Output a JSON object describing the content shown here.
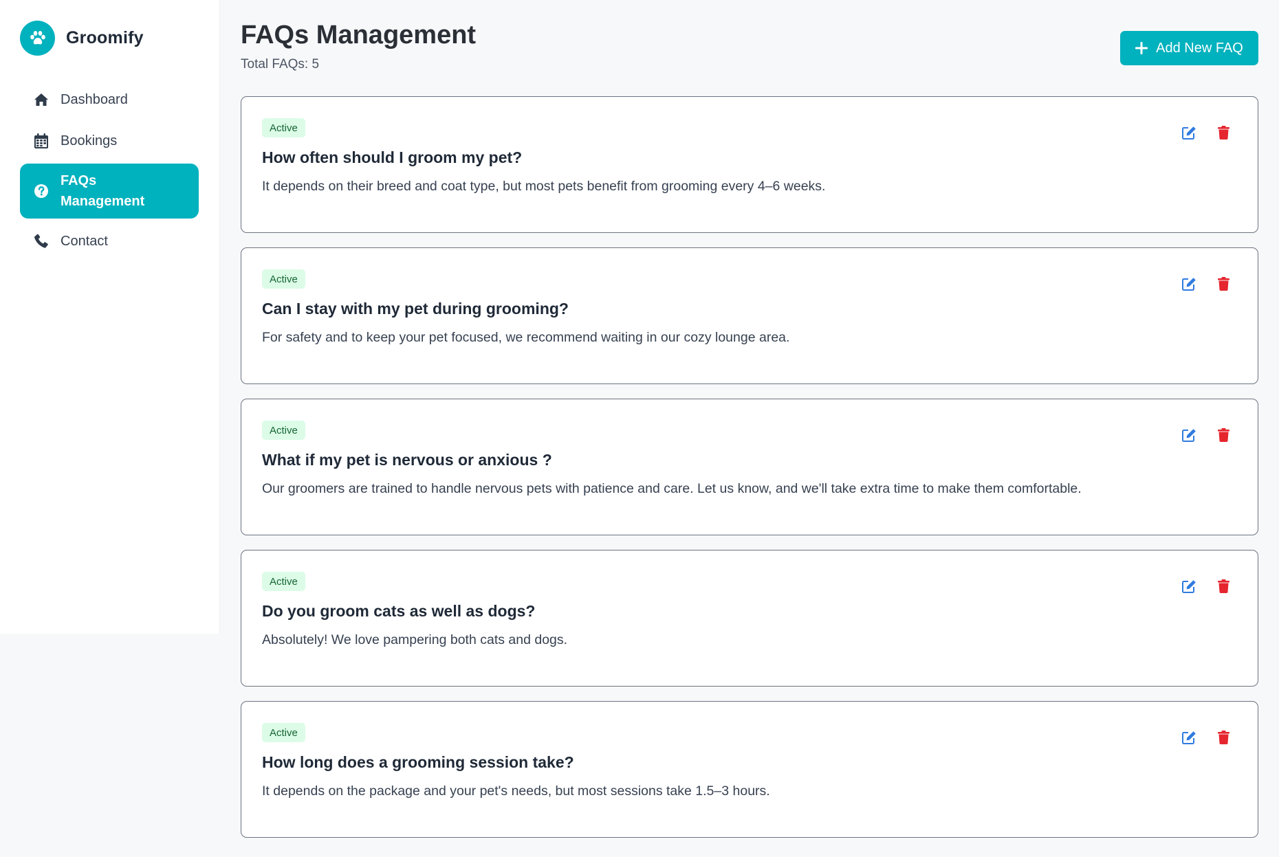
{
  "brand": {
    "name": "Groomify",
    "logo_icon": "paw-icon",
    "accent_color": "#00b1be"
  },
  "sidebar": {
    "items": [
      {
        "label": "Dashboard",
        "icon": "home-icon",
        "active": false
      },
      {
        "label": "Bookings",
        "icon": "calendar-icon",
        "active": false
      },
      {
        "label": "FAQs\nManagement",
        "label_line1": "FAQs",
        "label_line2": "Management",
        "icon": "question-circle-icon",
        "active": true
      },
      {
        "label": "Contact",
        "icon": "phone-icon",
        "active": false
      }
    ]
  },
  "header": {
    "title": "FAQs Management",
    "total_text": "Total FAQs: 5",
    "add_button_label": "Add New FAQ"
  },
  "faqs": [
    {
      "status": "Active",
      "question": "How often should I groom my pet?",
      "answer": "It depends on their breed and coat type, but most pets benefit from grooming every 4–6 weeks."
    },
    {
      "status": "Active",
      "question": "Can I stay with my pet during grooming?",
      "answer": "For safety and to keep your pet focused, we recommend waiting in our cozy lounge area."
    },
    {
      "status": "Active",
      "question": "What if my pet is nervous or anxious ?",
      "answer": "Our groomers are trained to handle nervous pets with patience and care. Let us know, and we'll take extra time to make them comfortable."
    },
    {
      "status": "Active",
      "question": "Do you groom cats as well as dogs?",
      "answer": "Absolutely! We love pampering both cats and dogs."
    },
    {
      "status": "Active",
      "question": "How long does a grooming session take?",
      "answer": "It depends on the package and your pet's needs, but most sessions take 1.5–3 hours."
    }
  ],
  "colors": {
    "edit": "#2f7be0",
    "delete": "#e5262f",
    "badge_bg": "#dcfce7",
    "badge_text": "#166534"
  }
}
